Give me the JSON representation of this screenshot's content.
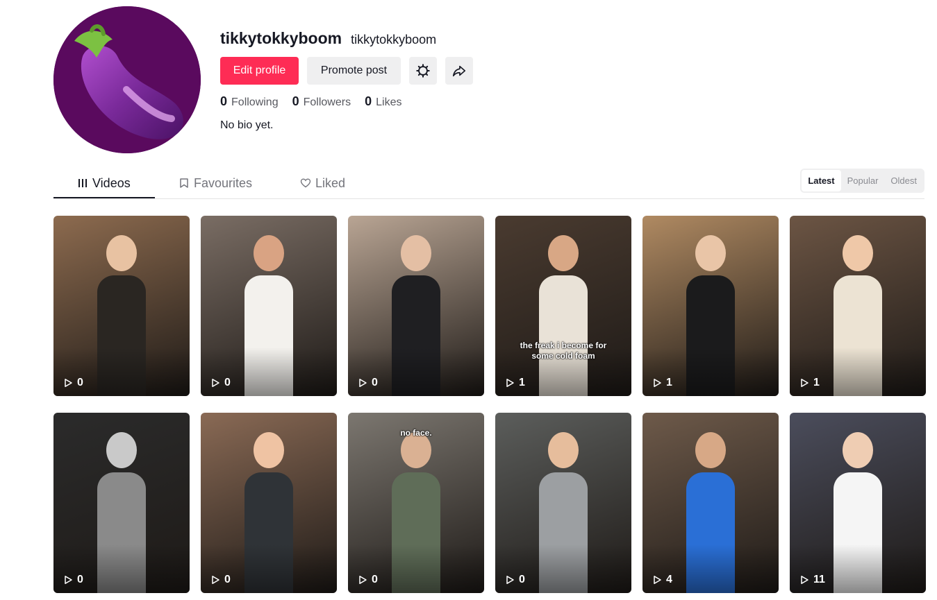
{
  "profile": {
    "display_name": "tikkytokkyboom",
    "username": "tikkytokkyboom",
    "avatar_icon": "eggplant-emoji",
    "bio": "No bio yet."
  },
  "actions": {
    "edit_profile": "Edit profile",
    "promote_post": "Promote post",
    "settings_icon": "gear-icon",
    "share_icon": "share-icon"
  },
  "stats": [
    {
      "value": "0",
      "label": "Following"
    },
    {
      "value": "0",
      "label": "Followers"
    },
    {
      "value": "0",
      "label": "Likes"
    }
  ],
  "tabs": [
    {
      "label": "Videos",
      "icon": "grid-icon",
      "active": true
    },
    {
      "label": "Favourites",
      "icon": "bookmark-icon",
      "active": false
    },
    {
      "label": "Liked",
      "icon": "heart-icon",
      "active": false
    }
  ],
  "sort": [
    {
      "label": "Latest",
      "active": true
    },
    {
      "label": "Popular",
      "active": false
    },
    {
      "label": "Oldest",
      "active": false
    }
  ],
  "colors": {
    "accent": "#fe2c55",
    "text": "#161823",
    "muted": "#73747b",
    "button_bg": "#efeff0"
  },
  "videos": [
    {
      "views": "0",
      "caption": "",
      "bg": "#8d6b4f",
      "skin": "#e8c2a2",
      "outfit": "#2a2622"
    },
    {
      "views": "0",
      "caption": "",
      "bg": "#7a6d64",
      "skin": "#d9a383",
      "outfit": "#f3f1ed"
    },
    {
      "views": "0",
      "caption": "",
      "bg": "#b9a594",
      "skin": "#e4bfa4",
      "outfit": "#1f1f22"
    },
    {
      "views": "1",
      "caption": "the freak i become for some cold foam",
      "bg": "#4a3b30",
      "skin": "#d8a785",
      "outfit": "#e9e2d7"
    },
    {
      "views": "1",
      "caption": "",
      "bg": "#b08a62",
      "skin": "#e9c5a7",
      "outfit": "#1b1b1c"
    },
    {
      "views": "1",
      "caption": "",
      "bg": "#6c5544",
      "skin": "#efc8a8",
      "outfit": "#ece3d3"
    },
    {
      "views": "0",
      "caption": "",
      "bg": "#2b2b2b",
      "skin": "#c9c9c9",
      "outfit": "#8a8a8a"
    },
    {
      "views": "0",
      "caption": "",
      "bg": "#8a6a55",
      "skin": "#efc3a3",
      "outfit": "#2f3337"
    },
    {
      "views": "0",
      "caption": "no face.",
      "bg": "#7c7770",
      "skin": "#dab193",
      "outfit": "#5f6d58"
    },
    {
      "views": "0",
      "caption": "",
      "bg": "#5c5e5c",
      "skin": "#e6bd9c",
      "outfit": "#9c9fa2"
    },
    {
      "views": "4",
      "caption": "",
      "bg": "#6e5a4a",
      "skin": "#d7a886",
      "outfit": "#2a6fd6"
    },
    {
      "views": "11",
      "caption": "",
      "bg": "#4b4d5c",
      "skin": "#efcdb3",
      "outfit": "#f5f5f5"
    }
  ]
}
